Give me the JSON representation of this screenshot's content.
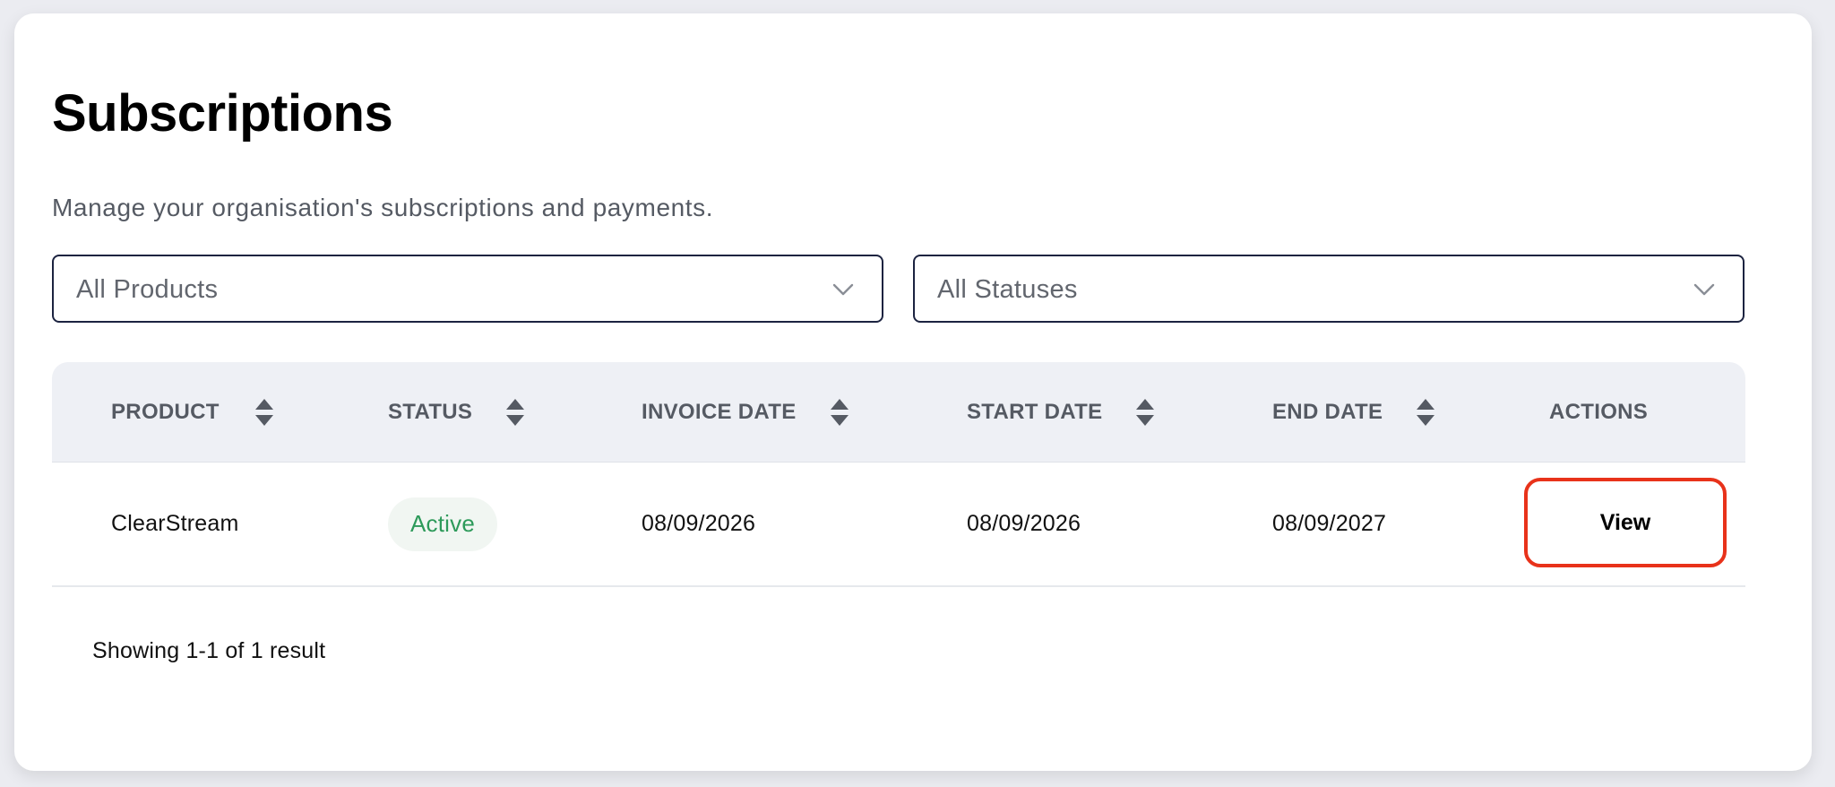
{
  "page": {
    "title": "Subscriptions",
    "subtitle": "Manage your organisation's subscriptions and payments."
  },
  "filters": {
    "product": {
      "value": "All Products",
      "icon": "chevron-down-icon"
    },
    "status": {
      "value": "All Statuses",
      "icon": "chevron-down-icon"
    }
  },
  "table": {
    "columns": [
      {
        "key": "product",
        "label": "PRODUCT",
        "sortable": true
      },
      {
        "key": "status",
        "label": "STATUS",
        "sortable": true
      },
      {
        "key": "invoice_date",
        "label": "INVOICE DATE",
        "sortable": true
      },
      {
        "key": "start_date",
        "label": "START DATE",
        "sortable": true
      },
      {
        "key": "end_date",
        "label": "END DATE",
        "sortable": true
      },
      {
        "key": "actions",
        "label": "ACTIONS",
        "sortable": false
      }
    ],
    "rows": [
      {
        "product": "ClearStream",
        "status": "Active",
        "invoice_date": "08/09/2026",
        "start_date": "08/09/2026",
        "end_date": "08/09/2027",
        "action_label": "View"
      }
    ],
    "footer": "Showing 1-1 of 1 result"
  },
  "colors": {
    "status_active_text": "#2d9a5a",
    "status_active_bg": "#f1f6f2",
    "highlight_border": "#e8321a",
    "filter_border": "#1c2340"
  }
}
